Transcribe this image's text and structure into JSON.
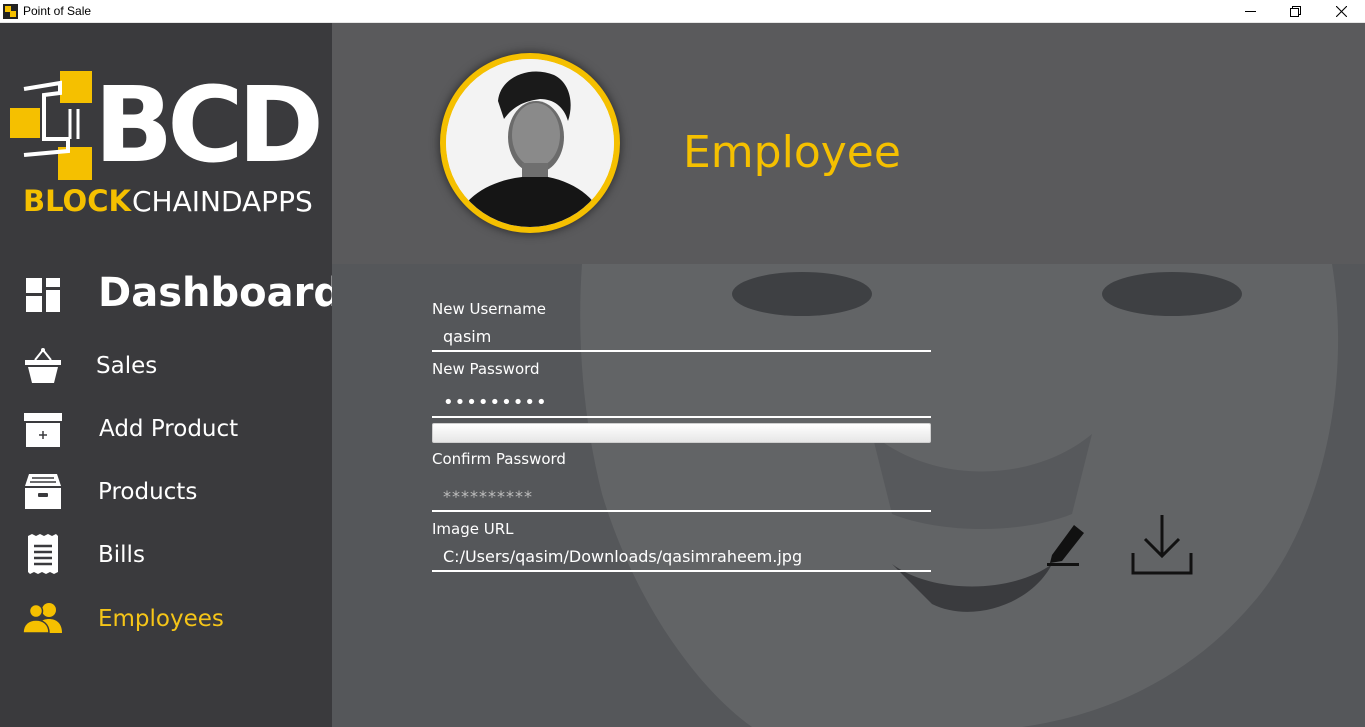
{
  "window": {
    "title": "Point of Sale"
  },
  "brand": {
    "logo_letters": "BCD",
    "logo_word_primary": "BLOCK",
    "logo_word_secondary": "CHAINDAPPS",
    "accent_color": "#f5c000"
  },
  "sidebar": {
    "items": [
      {
        "label": "Dashboard",
        "icon": "dashboard-icon"
      },
      {
        "label": "Sales",
        "icon": "basket-icon"
      },
      {
        "label": "Add Product",
        "icon": "add-box-icon"
      },
      {
        "label": "Products",
        "icon": "archive-icon"
      },
      {
        "label": "Bills",
        "icon": "receipt-icon"
      },
      {
        "label": "Employees",
        "icon": "people-icon",
        "active": true
      }
    ]
  },
  "header": {
    "title": "Employee"
  },
  "form": {
    "username_label": "New Username",
    "username_value": "qasim",
    "password_label": "New Password",
    "password_value": "qasim1234",
    "password_strength": 0.0,
    "confirm_label": "Confirm Password",
    "confirm_placeholder": "**********",
    "image_label": "Image URL",
    "image_value": "C:/Users/qasim/Downloads/qasimraheem.jpg"
  },
  "actions": {
    "edit_icon": "pencil-icon",
    "save_icon": "download-icon"
  }
}
